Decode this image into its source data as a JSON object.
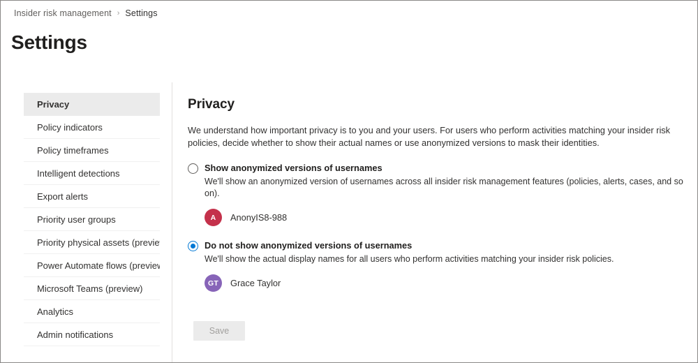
{
  "breadcrumb": {
    "items": [
      {
        "label": "Insider risk management",
        "current": false
      },
      {
        "label": "Settings",
        "current": true
      }
    ],
    "separator": "›"
  },
  "header": {
    "title": "Settings"
  },
  "sidebar": {
    "items": [
      {
        "label": "Privacy",
        "selected": true
      },
      {
        "label": "Policy indicators",
        "selected": false
      },
      {
        "label": "Policy timeframes",
        "selected": false
      },
      {
        "label": "Intelligent detections",
        "selected": false
      },
      {
        "label": "Export alerts",
        "selected": false
      },
      {
        "label": "Priority user groups",
        "selected": false
      },
      {
        "label": "Priority physical assets (preview)",
        "selected": false
      },
      {
        "label": "Power Automate flows (preview)",
        "selected": false
      },
      {
        "label": "Microsoft Teams (preview)",
        "selected": false
      },
      {
        "label": "Analytics",
        "selected": false
      },
      {
        "label": "Admin notifications",
        "selected": false
      }
    ]
  },
  "main": {
    "title": "Privacy",
    "description": "We understand how important privacy is to you and your users. For users who perform activities matching your insider risk policies, decide whether to show their actual names or use anonymized versions to mask their identities.",
    "options": [
      {
        "label": "Show anonymized versions of usernames",
        "sublabel": "We'll show an anonymized version of usernames across all insider risk management features (policies, alerts, cases, and so on).",
        "selected": false,
        "persona": {
          "initials": "A",
          "name": "AnonyIS8-988",
          "color": "#c4314b"
        }
      },
      {
        "label": "Do not show anonymized versions of usernames",
        "sublabel": "We'll show the actual display names for all users who perform activities matching your insider risk policies.",
        "selected": true,
        "persona": {
          "initials": "GT",
          "name": "Grace Taylor",
          "color": "#8764b8"
        }
      }
    ],
    "save_label": "Save"
  },
  "colors": {
    "accent": "#0078d4",
    "selected_nav_bg": "#ebebeb",
    "divider": "#e1dfdd",
    "disabled_button_bg": "#ebebeb",
    "disabled_button_text": "#a19f9d"
  }
}
